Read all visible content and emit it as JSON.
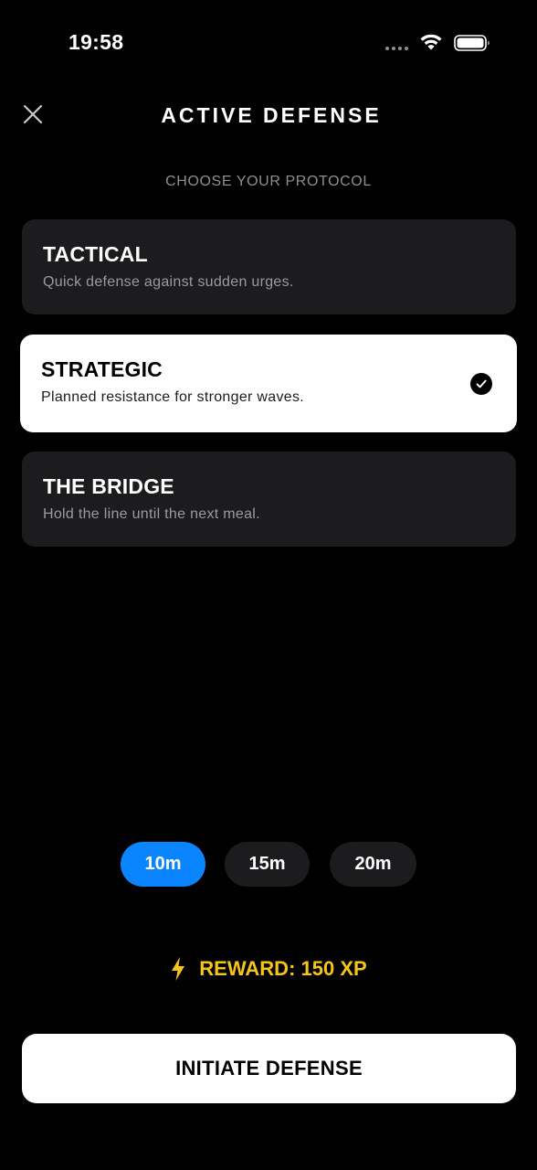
{
  "status_bar": {
    "time": "19:58",
    "icons": [
      "signal-dots-icon",
      "wifi-icon",
      "battery-icon"
    ]
  },
  "header": {
    "close_icon": "close-icon",
    "title": "ACTIVE DEFENSE"
  },
  "protocol": {
    "heading": "CHOOSE YOUR PROTOCOL",
    "selected": "STRATEGIC",
    "options": [
      {
        "title": "TACTICAL",
        "description": "Quick defense against sudden urges.",
        "selected": false
      },
      {
        "title": "STRATEGIC",
        "description": "Planned resistance for stronger waves.",
        "selected": true
      },
      {
        "title": "THE BRIDGE",
        "description": "Hold the line until the next meal.",
        "selected": false
      }
    ]
  },
  "duration": {
    "options": [
      "10m",
      "15m",
      "20m"
    ],
    "selected": "10m"
  },
  "reward": {
    "icon": "lightning-bolt-icon",
    "label": "REWARD: 150 XP"
  },
  "cta": {
    "label": "INITIATE DEFENSE"
  },
  "colors": {
    "background": "#000000",
    "card": "#1C1C1E",
    "selected_card": "#FFFFFF",
    "accent_blue": "#0A84FF",
    "reward_yellow": "#F5C518",
    "muted_text": "#8E8E93"
  }
}
